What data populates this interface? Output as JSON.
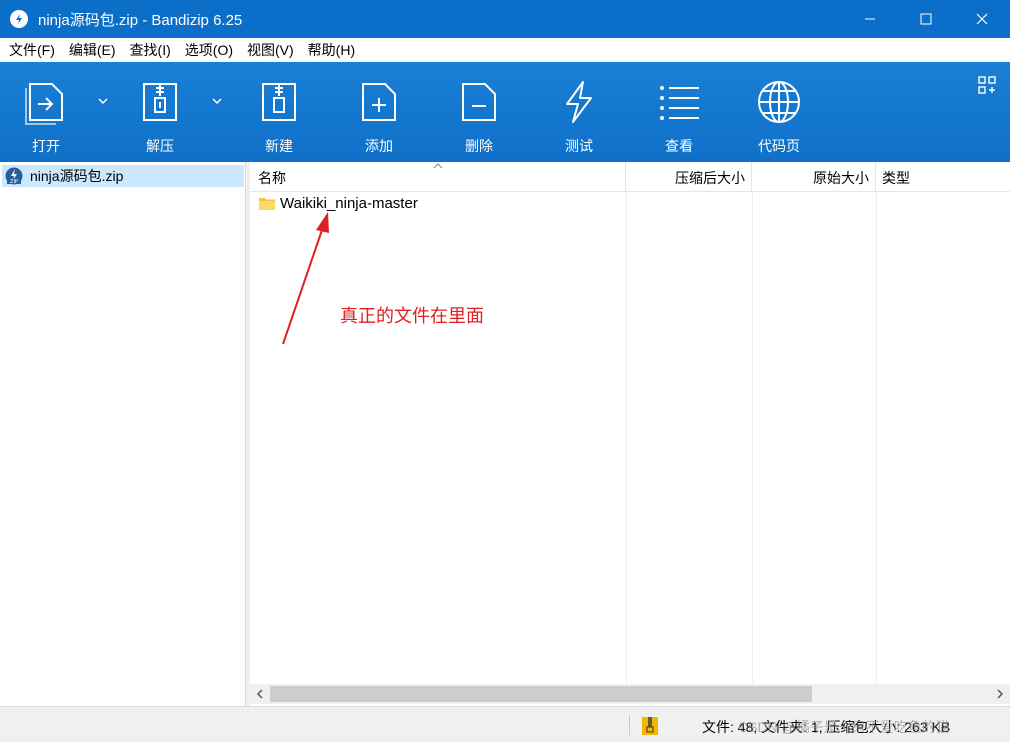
{
  "window": {
    "title": "ninja源码包.zip - Bandizip 6.25"
  },
  "menu": [
    "文件(F)",
    "编辑(E)",
    "查找(I)",
    "选项(O)",
    "视图(V)",
    "帮助(H)"
  ],
  "toolbar": {
    "open": "打开",
    "extract": "解压",
    "new": "新建",
    "add": "添加",
    "delete": "删除",
    "test": "测试",
    "view": "查看",
    "codepage": "代码页"
  },
  "tree": {
    "item": "ninja源码包.zip"
  },
  "columns": {
    "name": "名称",
    "packed": "压缩后大小",
    "original": "原始大小",
    "type": "类型"
  },
  "files": [
    {
      "name": "Waikiki_ninja-master",
      "icon": "folder-icon"
    }
  ],
  "annotation": "真正的文件在里面",
  "status": {
    "text": "文件: 48, 文件夹: 1, 压缩包大小: 263 KB",
    "watermark": "CSDN @橘子是一只不爱吃鱼的猫"
  },
  "colors": {
    "titlebar": "#0b6fc9",
    "toolbar": "#1577d0",
    "selection": "#cce8ff",
    "annotation": "#e02020"
  }
}
